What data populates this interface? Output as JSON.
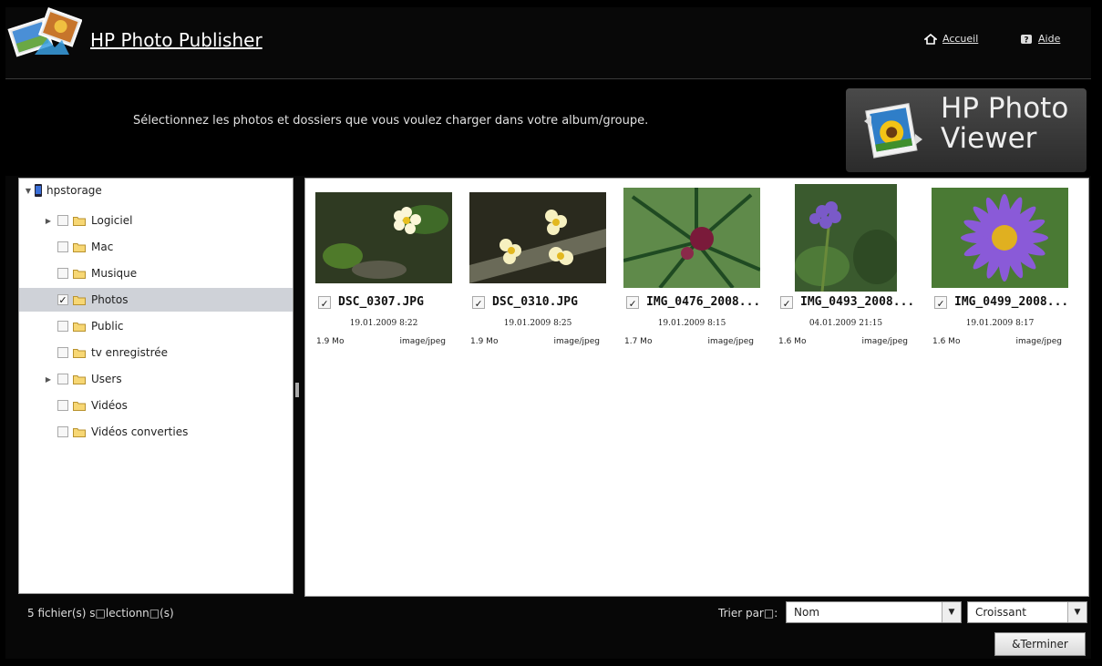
{
  "header": {
    "title": "HP Photo Publisher",
    "home_link": "Accueil",
    "help_link": "Aide"
  },
  "instruction": "Sélectionnez les photos et dossiers que vous voulez charger dans votre album/groupe.",
  "viewer_badge": {
    "line1": "HP Photo",
    "line2": "Viewer"
  },
  "tree": {
    "root": "hpstorage",
    "items": [
      {
        "label": "Logiciel",
        "expandable": true,
        "checked": false,
        "selected": false
      },
      {
        "label": "Mac",
        "expandable": false,
        "checked": false,
        "selected": false
      },
      {
        "label": "Musique",
        "expandable": false,
        "checked": false,
        "selected": false
      },
      {
        "label": "Photos",
        "expandable": false,
        "checked": true,
        "selected": true
      },
      {
        "label": "Public",
        "expandable": false,
        "checked": false,
        "selected": false
      },
      {
        "label": "tv enregistrée",
        "expandable": false,
        "checked": false,
        "selected": false
      },
      {
        "label": "Users",
        "expandable": true,
        "checked": false,
        "selected": false
      },
      {
        "label": "Vidéos",
        "expandable": false,
        "checked": false,
        "selected": false
      },
      {
        "label": "Vidéos converties",
        "expandable": false,
        "checked": false,
        "selected": false
      }
    ]
  },
  "photos": [
    {
      "name": "DSC_0307.JPG",
      "date": "19.01.2009 8:22",
      "size": "1.9 Mo",
      "type": "image/jpeg",
      "checked": true
    },
    {
      "name": "DSC_0310.JPG",
      "date": "19.01.2009 8:25",
      "size": "1.9 Mo",
      "type": "image/jpeg",
      "checked": true
    },
    {
      "name": "IMG_0476_2008...",
      "date": "19.01.2009 8:15",
      "size": "1.7 Mo",
      "type": "image/jpeg",
      "checked": true
    },
    {
      "name": "IMG_0493_2008...",
      "date": "04.01.2009 21:15",
      "size": "1.6 Mo",
      "type": "image/jpeg",
      "checked": true
    },
    {
      "name": "IMG_0499_2008...",
      "date": "19.01.2009 8:17",
      "size": "1.6 Mo",
      "type": "image/jpeg",
      "checked": true
    }
  ],
  "footer": {
    "status": "5 fichier(s) s□lectionn□(s)",
    "sort_label": "Trier par□:",
    "sort_field": "Nom",
    "sort_order": "Croissant",
    "finish_button": "&Terminer"
  },
  "icons": {
    "check": "✓",
    "expand": "▶",
    "collapse": "▼",
    "dropdown": "▼"
  }
}
